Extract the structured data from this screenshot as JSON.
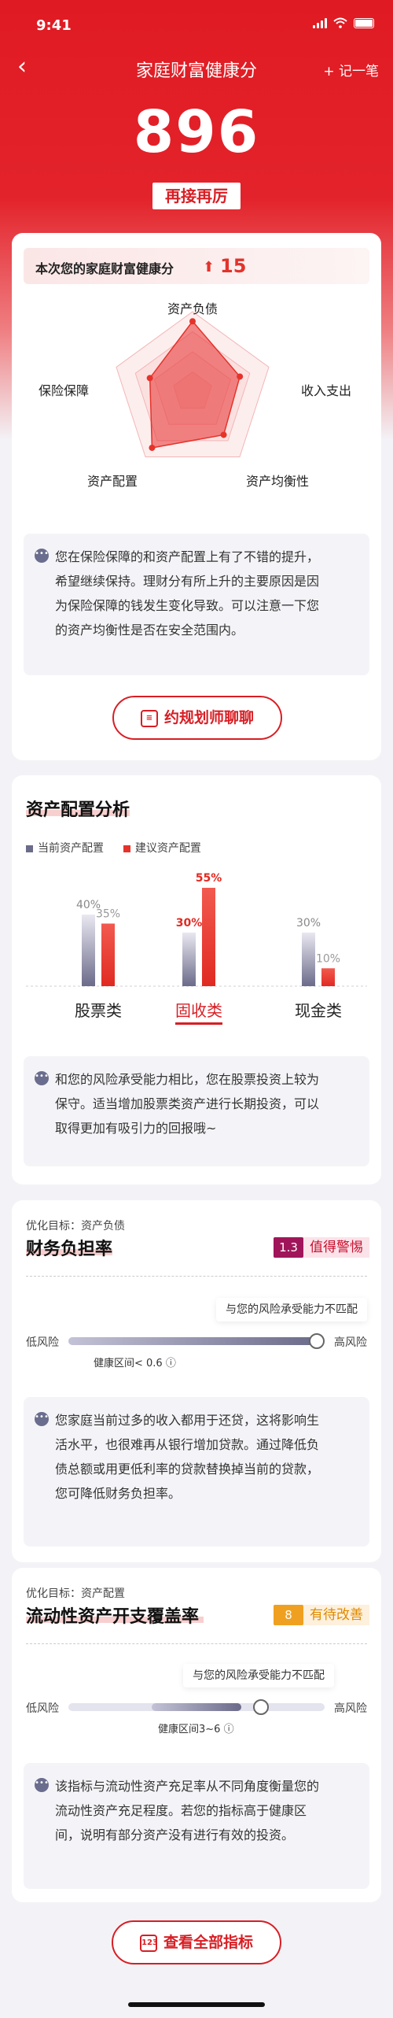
{
  "status_bar": {
    "time": "9:41"
  },
  "nav": {
    "back": "‹",
    "title": "家庭财富健康分",
    "add": "+ 记一笔"
  },
  "hero": {
    "score": "896",
    "badge": "再接再厉"
  },
  "health_card": {
    "label": "本次您的家庭财富健康分",
    "delta": "15",
    "radar_labels": [
      "资产负债",
      "收入支出",
      "资产均衡性",
      "资产配置",
      "保险保障"
    ],
    "radar_levels": [
      0.88,
      0.62,
      0.66,
      0.86,
      0.56
    ],
    "note": "您在保险保障的和资产配置上有了不错的提升，希望继续保持。理财分有所上升的主要原因是因为保险保障的钱发生变化导致。可以注意一下您的资产均衡性是否在安全范围内。",
    "note_lines": [
      "您在保险保障的和资产配置上有了不错的提升，",
      "希望继续保持。理财分有所上升的主要原因是因",
      "为保险保障的钱发生变化导致。可以注意一下您",
      "的资产均衡性是否在安全范围内。"
    ],
    "chat_button": "约规划师聊聊"
  },
  "allocation": {
    "title": "资产配置分析",
    "legend_current": "当前资产配置",
    "legend_suggested": "建议资产配置",
    "chart_data": {
      "type": "bar",
      "categories": [
        "股票类",
        "固收类",
        "现金类"
      ],
      "series": [
        {
          "name": "当前资产配置",
          "values": [
            40,
            30,
            30
          ]
        },
        {
          "name": "建议资产配置",
          "values": [
            35,
            55,
            10
          ]
        }
      ],
      "value_labels": [
        [
          "40%",
          "35%"
        ],
        [
          "30%",
          "55%"
        ],
        [
          "30%",
          "10%"
        ]
      ],
      "selected_category": "固收类",
      "ylim": [
        0,
        60
      ]
    },
    "note_lines": [
      "和您的风险承受能力相比，您在股票投资上较为",
      "保守。适当增加股票类资产进行长期投资，可以",
      "取得更加有吸引力的回报哦~"
    ]
  },
  "debt": {
    "goal": "优化目标：资产负债",
    "title": "财务负担率",
    "badge_num": "1.3",
    "badge_text": "值得警惕",
    "tip": "与您的风险承受能力不匹配",
    "low": "低风险",
    "high": "高风险",
    "zone": "健康区间< 0.6",
    "level": 0.97,
    "note_lines": [
      "您家庭当前过多的收入都用于还贷，这将影响生",
      "活水平，也很难再从银行增加贷款。通过降低负",
      "债总额或用更低利率的贷款替换掉当前的贷款，",
      "您可降低财务负担率。"
    ]
  },
  "liquidity": {
    "goal": "优化目标：资产配置",
    "title": "流动性资产开支覆盖率",
    "badge_num": "8",
    "badge_text": "有待改善",
    "tip": "与您的风险承受能力不匹配",
    "low": "低风险",
    "high": "高风险",
    "zone": "健康区间3~6",
    "level": 0.75,
    "note_lines": [
      "该指标与流动性资产充足率从不同角度衡量您的",
      "流动性资产充足程度。若您的指标高于健康区",
      "间，说明有部分资产没有进行有效的投资。"
    ]
  },
  "footer": {
    "all_button": "查看全部指标",
    "icon_text": "123"
  },
  "colors": {
    "brand": "#d81e24",
    "warn_magenta": "#a0155a",
    "warn_orange": "#f0a020",
    "current_bar": "#6b6b8a"
  }
}
